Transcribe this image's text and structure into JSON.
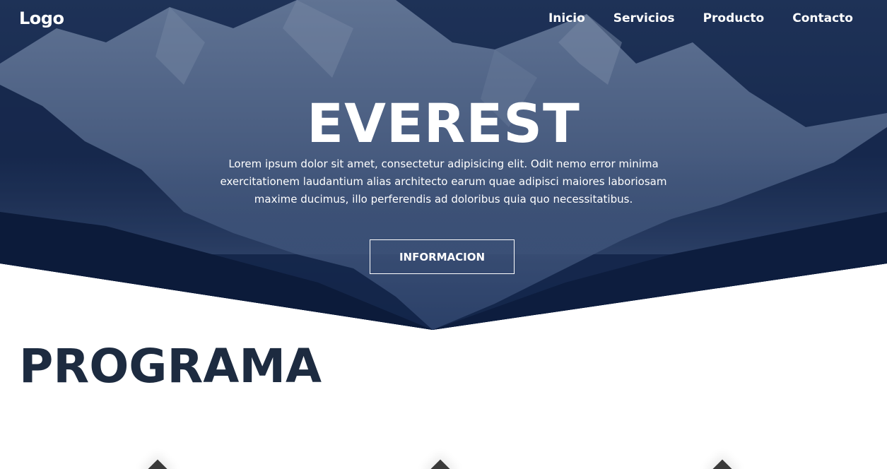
{
  "header": {
    "logo": "Logo",
    "nav": [
      "Inicio",
      "Servicios",
      "Producto",
      "Contacto"
    ]
  },
  "hero": {
    "title": "EVEREST",
    "text": "Lorem ipsum dolor sit amet, consectetur adipisicing elit. Odit nemo error minima exercitationem laudantium alias architecto earum quae adipisci maiores laboriosam maxime ducimus, illo perferendis ad doloribus quia quo necessitatibus.",
    "button": "INFORMACION"
  },
  "program": {
    "title": "PROGRAMA"
  },
  "colors": {
    "hero_overlay": "#0d1c3f",
    "title_dark": "#1d2b40",
    "text_light": "#ffffff"
  }
}
